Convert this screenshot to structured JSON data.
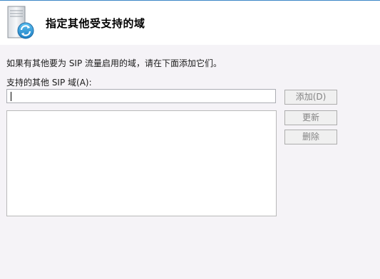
{
  "header": {
    "title": "指定其他受支持的域",
    "icon": "server-sync-icon"
  },
  "description": "如果有其他要为 SIP 流量启用的域，请在下面添加它们。",
  "domain_field": {
    "label": "支持的其他 SIP 域(A):",
    "value": ""
  },
  "domain_list": {
    "items": []
  },
  "buttons": {
    "add": "添加(D)",
    "update": "更新",
    "delete": "删除"
  },
  "colors": {
    "accent": "#3b86c6",
    "background": "#f5f3f7",
    "disabled_text": "#838383"
  }
}
